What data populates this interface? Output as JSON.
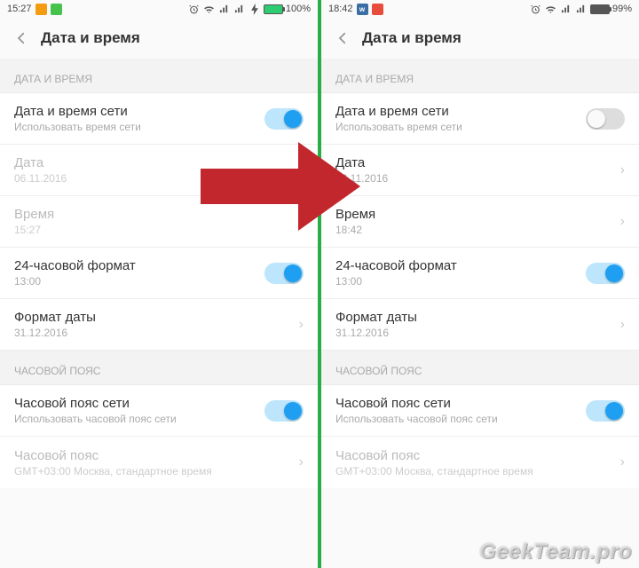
{
  "left": {
    "status": {
      "time": "15:27",
      "battery": "100%"
    },
    "header": {
      "title": "Дата и время"
    },
    "section1": "ДАТА И ВРЕМЯ",
    "net_time": {
      "title": "Дата и время сети",
      "sub": "Использовать время сети",
      "on": true
    },
    "date": {
      "title": "Дата",
      "sub": "06.11.2016"
    },
    "time": {
      "title": "Время",
      "sub": "15:27"
    },
    "fmt24": {
      "title": "24-часовой формат",
      "sub": "13:00",
      "on": true
    },
    "date_fmt": {
      "title": "Формат даты",
      "sub": "31.12.2016"
    },
    "section2": "ЧАСОВОЙ ПОЯС",
    "tz_net": {
      "title": "Часовой пояс сети",
      "sub": "Использовать часовой пояс сети",
      "on": true
    },
    "tz": {
      "title": "Часовой пояс",
      "sub": "GMT+03:00 Москва, стандартное время"
    }
  },
  "right": {
    "status": {
      "time": "18:42",
      "battery": "99%"
    },
    "header": {
      "title": "Дата и время"
    },
    "section1": "ДАТА И ВРЕМЯ",
    "net_time": {
      "title": "Дата и время сети",
      "sub": "Использовать время сети",
      "on": false
    },
    "date": {
      "title": "Дата",
      "sub": "06.11.2016"
    },
    "time": {
      "title": "Время",
      "sub": "18:42"
    },
    "fmt24": {
      "title": "24-часовой формат",
      "sub": "13:00",
      "on": true
    },
    "date_fmt": {
      "title": "Формат даты",
      "sub": "31.12.2016"
    },
    "section2": "ЧАСОВОЙ ПОЯС",
    "tz_net": {
      "title": "Часовой пояс сети",
      "sub": "Использовать часовой пояс сети",
      "on": true
    },
    "tz": {
      "title": "Часовой пояс",
      "sub": "GMT+03:00 Москва, стандартное время"
    }
  },
  "watermark": "GeekTeam.pro"
}
